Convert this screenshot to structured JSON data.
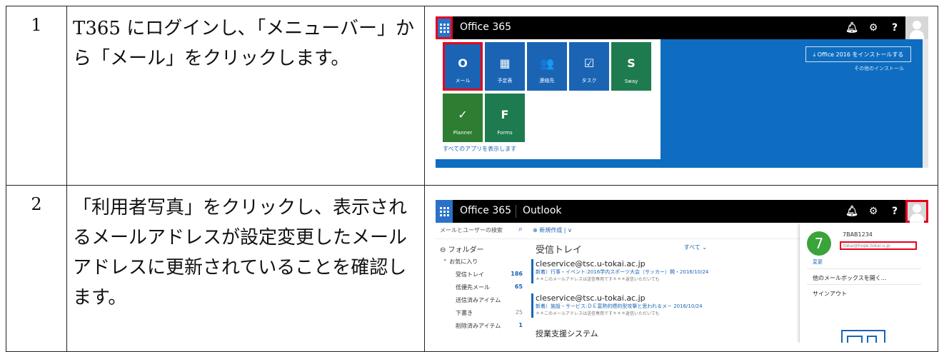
{
  "steps": [
    {
      "number": "1",
      "text": "T365 にログインし､「メニューバー」から「メール」をクリックします。"
    },
    {
      "number": "2",
      "text": "「利用者写真」をクリックし、表示されるメールアドレスが設定変更したメールアドレスに更新されていることを確認します。"
    }
  ],
  "shot1": {
    "app_title": "Office 365",
    "install_button": "⤓ Office 2016 をインストールする",
    "install_other": "その他のインストール",
    "tiles": [
      {
        "label": "メール",
        "icon": "O",
        "color": "#1b64b4"
      },
      {
        "label": "予定表",
        "icon": "▦",
        "color": "#1b64b4"
      },
      {
        "label": "連絡先",
        "icon": "👥",
        "color": "#1b64b4"
      },
      {
        "label": "タスク",
        "icon": "☑",
        "color": "#1b64b4"
      },
      {
        "label": "Sway",
        "icon": "S",
        "color": "#1e7b4f"
      },
      {
        "label": "Planner",
        "icon": "✓",
        "color": "#2e7d32"
      },
      {
        "label": "Forms",
        "icon": "F",
        "color": "#1e7b4f"
      }
    ],
    "all_apps": "すべてのアプリを表示します"
  },
  "shot2": {
    "app_title": "Office 365",
    "app_name": "Outlook",
    "search_hint": "メールとユーザーの検索",
    "new_mail": "⊕ 新規作成 | ∨",
    "folders_label": "⊖ フォルダー",
    "favorites_label": "⌃ お気に入り",
    "nav_items": [
      {
        "label": "受信トレイ",
        "count": "186"
      },
      {
        "label": "低優先メール",
        "count": "65"
      },
      {
        "label": "送信済みアイテム",
        "count": ""
      },
      {
        "label": "下書き",
        "count": "25"
      },
      {
        "label": "削除済みアイテム",
        "count": "1"
      }
    ],
    "inbox_title": "受信トレイ",
    "inbox_filter": "すべて ⌄",
    "mails": [
      {
        "from": "cleservice@tsc.u-tokai.ac.jp",
        "subject": "新着）行事・イベント:2016学内スポーツ大会（サッカー）開・2016/10/24",
        "preview": "＊＊このメールアドレスは送信専用です＊＊＊返信いただいても"
      },
      {
        "from": "cleservice@tsc.u-tokai.ac.jp",
        "subject": "新着）施設・サービス:ＤＥ富熱的標的型攻撃と思われるメ－ 2016/10/24",
        "preview": "＊＊このメールアドレスは送信専用です＊＊＊返信いただいても"
      },
      {
        "from": "授業支援システム",
        "subject": "",
        "preview": ""
      }
    ],
    "panel": {
      "initial": "7",
      "user_id": "7BAB1234",
      "email": "tokai@hope.tokai-u.jp",
      "change": "変更",
      "open_other": "他のメールボックスを開く...",
      "sign_out": "サインアウト"
    }
  }
}
